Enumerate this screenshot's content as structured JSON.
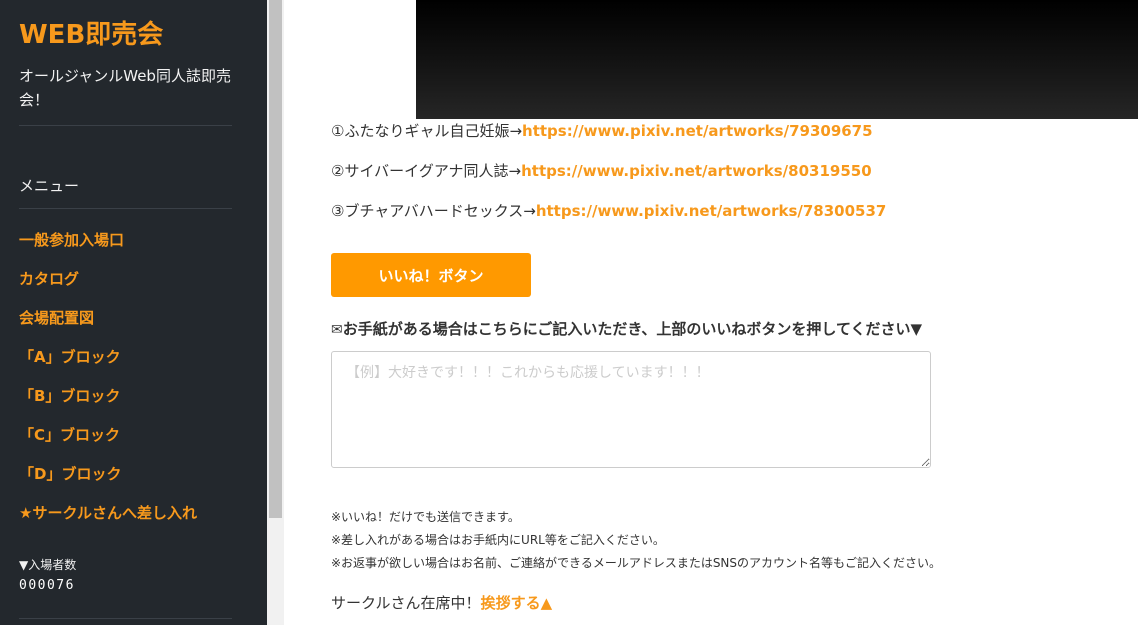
{
  "sidebar": {
    "site_title": "WEB即売会",
    "site_description": "オールジャンルWeb同人誌即売会！",
    "menu_heading": "メニュー",
    "nav_items": [
      "一般参加入場口",
      "カタログ",
      "会場配置図",
      "「A」ブロック",
      "「B」ブロック",
      "「C」ブロック",
      "「D」ブロック",
      "★サークルさんへ差し入れ"
    ],
    "visitor_counter_label": "▼入場者数",
    "visitor_counter_value": "000076"
  },
  "main": {
    "works": [
      {
        "title": "①ふたなりギャル自己妊娠→",
        "url": "https://www.pixiv.net/artworks/79309675"
      },
      {
        "title": "②サイバーイグアナ同人誌→",
        "url": "https://www.pixiv.net/artworks/80319550"
      },
      {
        "title": "③ブチャアバハードセックス→",
        "url": "https://www.pixiv.net/artworks/78300537"
      }
    ],
    "like_button_label": "いいね！ボタン",
    "letter_prompt_icon": "✉",
    "letter_prompt": "お手紙がある場合はこちらにご記入いただき、上部のいいねボタンを押してください▼",
    "message_placeholder": "【例】大好きです！！！これからも応援しています！！！",
    "message_value": "",
    "notes": [
      "※いいね！だけでも送信できます。",
      "※差し入れがある場合はお手紙内にURL等をご記入ください。",
      "※お返事が欲しい場合はお名前、ご連絡ができるメールアドレスまたはSNSのアカウント名等もご記入ください。"
    ],
    "greeting_text": "サークルさん在席中！",
    "greeting_link": "挨拶する▲"
  },
  "colors": {
    "accent": "#f7991c",
    "button": "#ff9900",
    "sidebar_bg": "#23282d"
  }
}
